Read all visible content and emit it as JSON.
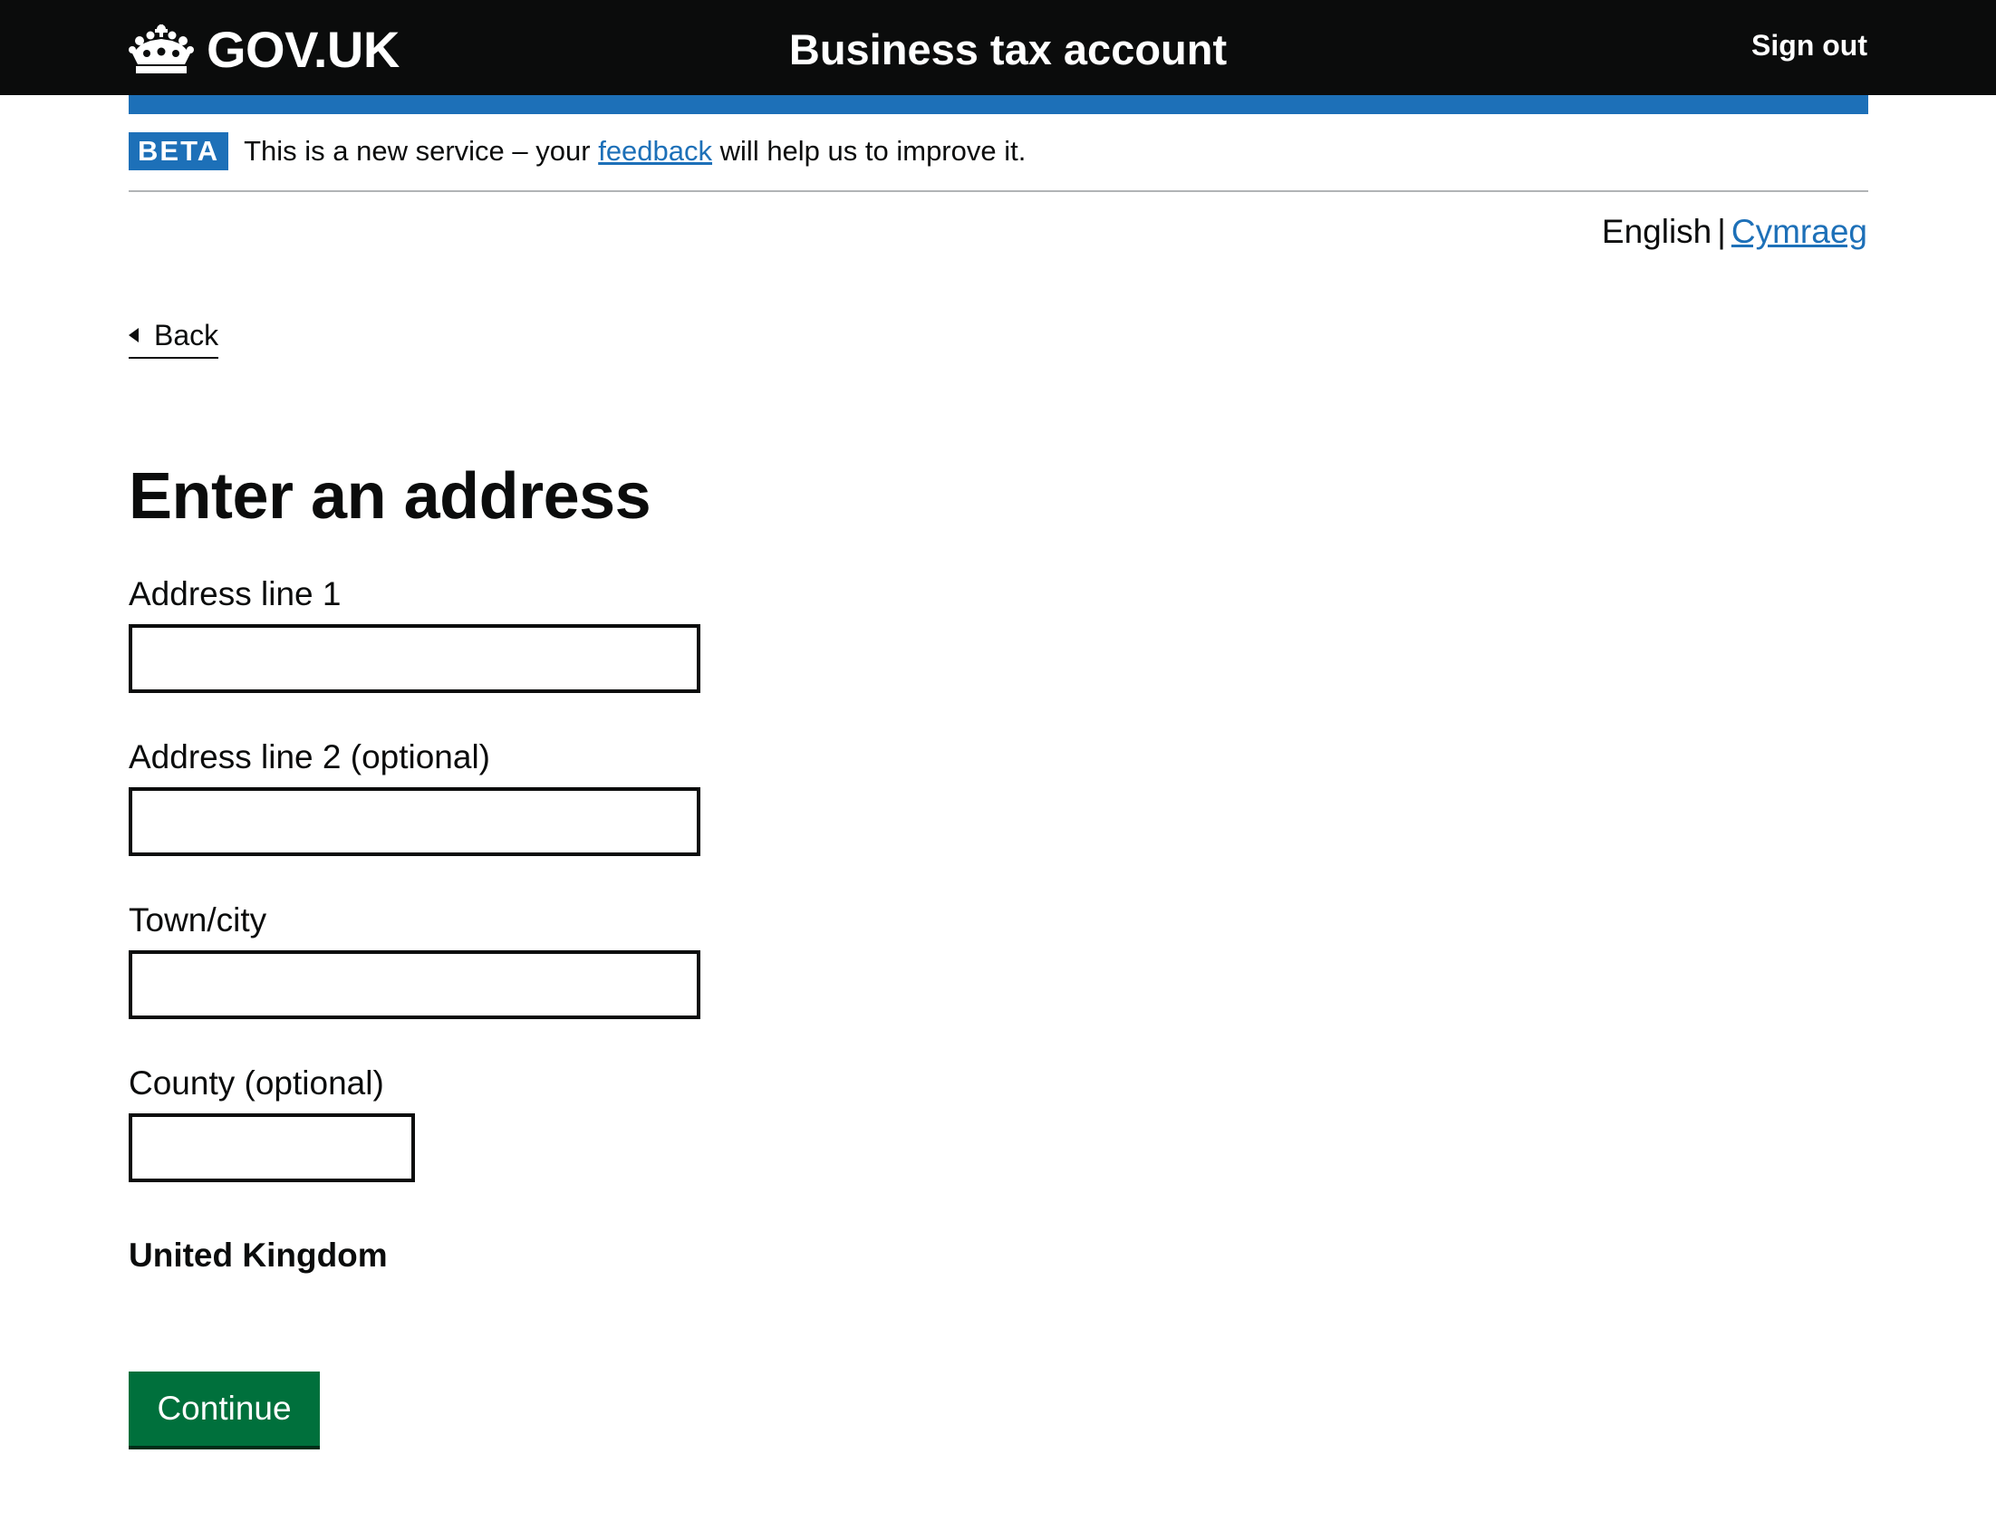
{
  "header": {
    "logo_text": "GOV.UK",
    "service_name": "Business tax account",
    "sign_out": "Sign out"
  },
  "phase_banner": {
    "tag": "BETA",
    "text_before": "This is a new service – your",
    "link": "feedback",
    "text_after": "will help us to improve it."
  },
  "language": {
    "current": "English",
    "separator": "|",
    "other": "Cymraeg"
  },
  "back_link": "Back",
  "page_title": "Enter an address",
  "form": {
    "address_line_1": {
      "label": "Address line 1",
      "value": ""
    },
    "address_line_2": {
      "label": "Address line 2 (optional)",
      "value": ""
    },
    "town_city": {
      "label": "Town/city",
      "value": ""
    },
    "county": {
      "label": "County (optional)",
      "value": ""
    },
    "country": "United Kingdom",
    "submit_label": "Continue"
  },
  "colors": {
    "header_bg": "#0b0c0c",
    "brand_blue": "#1d70b8",
    "button_green": "#00703c"
  }
}
